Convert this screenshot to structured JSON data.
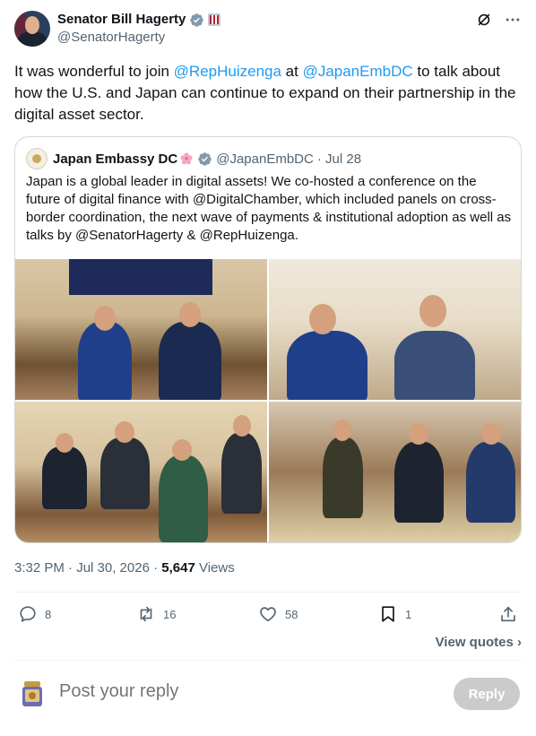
{
  "author": {
    "name": "Senator Bill Hagerty",
    "handle": "@SenatorHagerty"
  },
  "tweet": {
    "text_1": "It was wonderful to join ",
    "mention_1": "@RepHuizenga",
    "text_2": " at ",
    "mention_2": "@JapanEmbDC",
    "text_3": " to talk about how the U.S. and Japan can continue to expand on their partnership in the digital asset sector."
  },
  "quote": {
    "name": "Japan Embassy DC",
    "handle": "@JapanEmbDC",
    "date": "· Jul 28",
    "text": "Japan is a global leader in digital assets! We co-hosted a conference on the future of digital finance with @DigitalChamber, which included panels on cross-border coordination, the next wave of payments & institutional adoption as well as talks by @SenatorHagerty & @RepHuizenga."
  },
  "meta": {
    "time": "3:32 PM · Jul 30, 2026 · ",
    "views_count": "5,647",
    "views_label": " Views"
  },
  "actions": {
    "replies": "8",
    "reposts": "16",
    "likes": "58",
    "bookmarks": "1"
  },
  "view_quotes": "View quotes ›",
  "reply": {
    "placeholder": "Post your reply",
    "button": "Reply"
  },
  "colors": {
    "accent": "#1d9bf0",
    "secondary_text": "#536471",
    "reply_button_disabled": "#c9cbcd"
  }
}
